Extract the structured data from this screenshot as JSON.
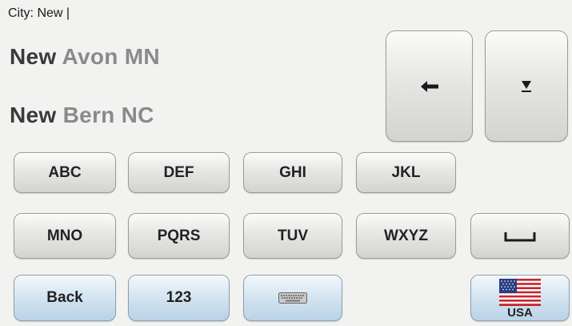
{
  "input": {
    "label": "City:",
    "value": "New",
    "cursor": "|"
  },
  "suggestions": [
    {
      "typed": "New",
      "rest": " Avon MN"
    },
    {
      "typed": "New",
      "rest": " Bern NC"
    }
  ],
  "keys": {
    "row1": [
      "ABC",
      "DEF",
      "GHI",
      "JKL"
    ],
    "row2": [
      "MNO",
      "PQRS",
      "TUV",
      "WXYZ"
    ],
    "back": "Back",
    "numbers": "123",
    "country": "USA"
  },
  "icons": {
    "backspace": "left-arrow-icon",
    "hide_list": "list-down-icon",
    "space": "space-bar-icon",
    "keyboard": "keyboard-icon",
    "flag": "us-flag-icon"
  },
  "colors": {
    "key_face": "#e6e6e4",
    "blue_key": "#c8dcec",
    "typed_text": "#3a3a3a",
    "rest_text": "#8a8a8a"
  }
}
